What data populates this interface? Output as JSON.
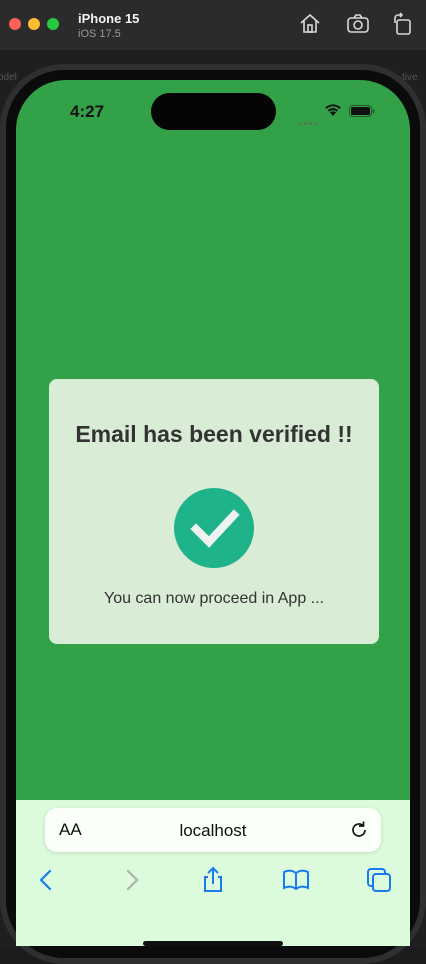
{
  "window": {
    "device_name": "iPhone 15",
    "os_version": "iOS 17.5",
    "icons": [
      "home-icon",
      "camera-icon",
      "rotate-icon"
    ],
    "backdrop_left": "odel",
    "backdrop_right": "tive"
  },
  "status_bar": {
    "time": "4:27",
    "icons": [
      "signal-icon",
      "wifi-icon",
      "battery-icon"
    ]
  },
  "page": {
    "background_color": "#32a148",
    "card": {
      "title": "Email has been verified !!",
      "message": "You can now proceed in App ...",
      "icon": "checkmark-circle-icon",
      "icon_color": "#1eb38a"
    }
  },
  "safari": {
    "text_size_label": "AA",
    "url": "localhost",
    "toolbar": [
      "back-icon",
      "forward-icon",
      "share-icon",
      "bookmarks-icon",
      "tabs-icon"
    ]
  }
}
